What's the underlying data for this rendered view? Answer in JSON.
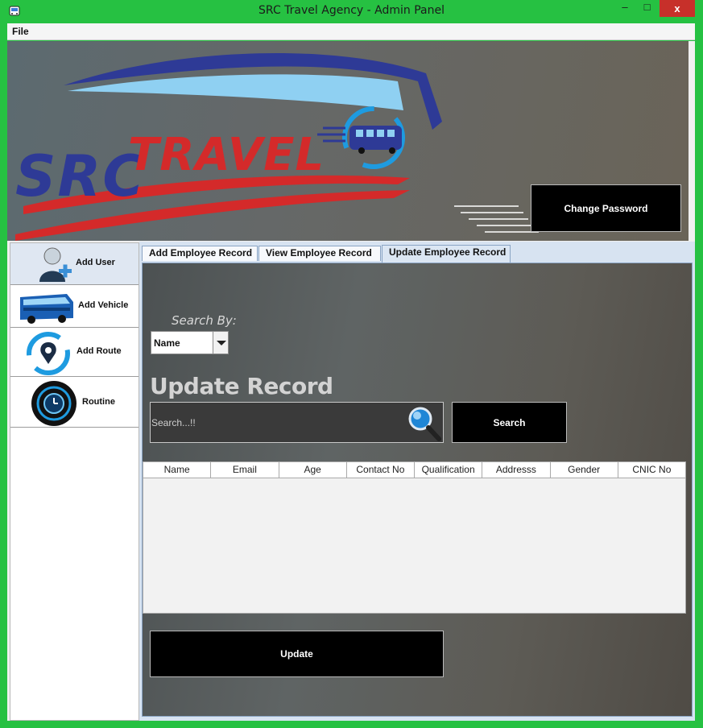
{
  "window": {
    "title": "SRC Travel Agency - Admin Panel",
    "minimize": "–",
    "maximize": "□",
    "close": "x"
  },
  "menu": {
    "file": "File"
  },
  "banner": {
    "logo_alt": "SRC TRAVEL",
    "change_password": "Change Password"
  },
  "sidebar": {
    "items": [
      {
        "label": "Add User",
        "icon": "user-add-icon",
        "active": true
      },
      {
        "label": "Add Vehicle",
        "icon": "bus-icon",
        "active": false
      },
      {
        "label": "Add Route",
        "icon": "route-pin-icon",
        "active": false
      },
      {
        "label": "Routine",
        "icon": "clock-icon",
        "active": false
      }
    ]
  },
  "tabs": [
    {
      "label": "Add Employee Record",
      "active": false
    },
    {
      "label": "View Employee Record",
      "active": false
    },
    {
      "label": "Update Employee Record",
      "active": true
    }
  ],
  "form": {
    "search_by_label": "Search By:",
    "search_by_value": "Name",
    "heading": "Update Record",
    "search_placeholder": "Search...!!",
    "search_button": "Search",
    "update_button": "Update"
  },
  "table": {
    "columns": [
      "Name",
      "Email",
      "Age",
      "Contact No",
      "Qualification",
      "Addresss",
      "Gender",
      "CNIC No"
    ],
    "rows": []
  },
  "colors": {
    "window_frame": "#26c142",
    "close_button": "#c7302a",
    "logo_red": "#d42a2a",
    "logo_blue": "#2e3a96",
    "logo_light_blue": "#8fd0f2"
  }
}
